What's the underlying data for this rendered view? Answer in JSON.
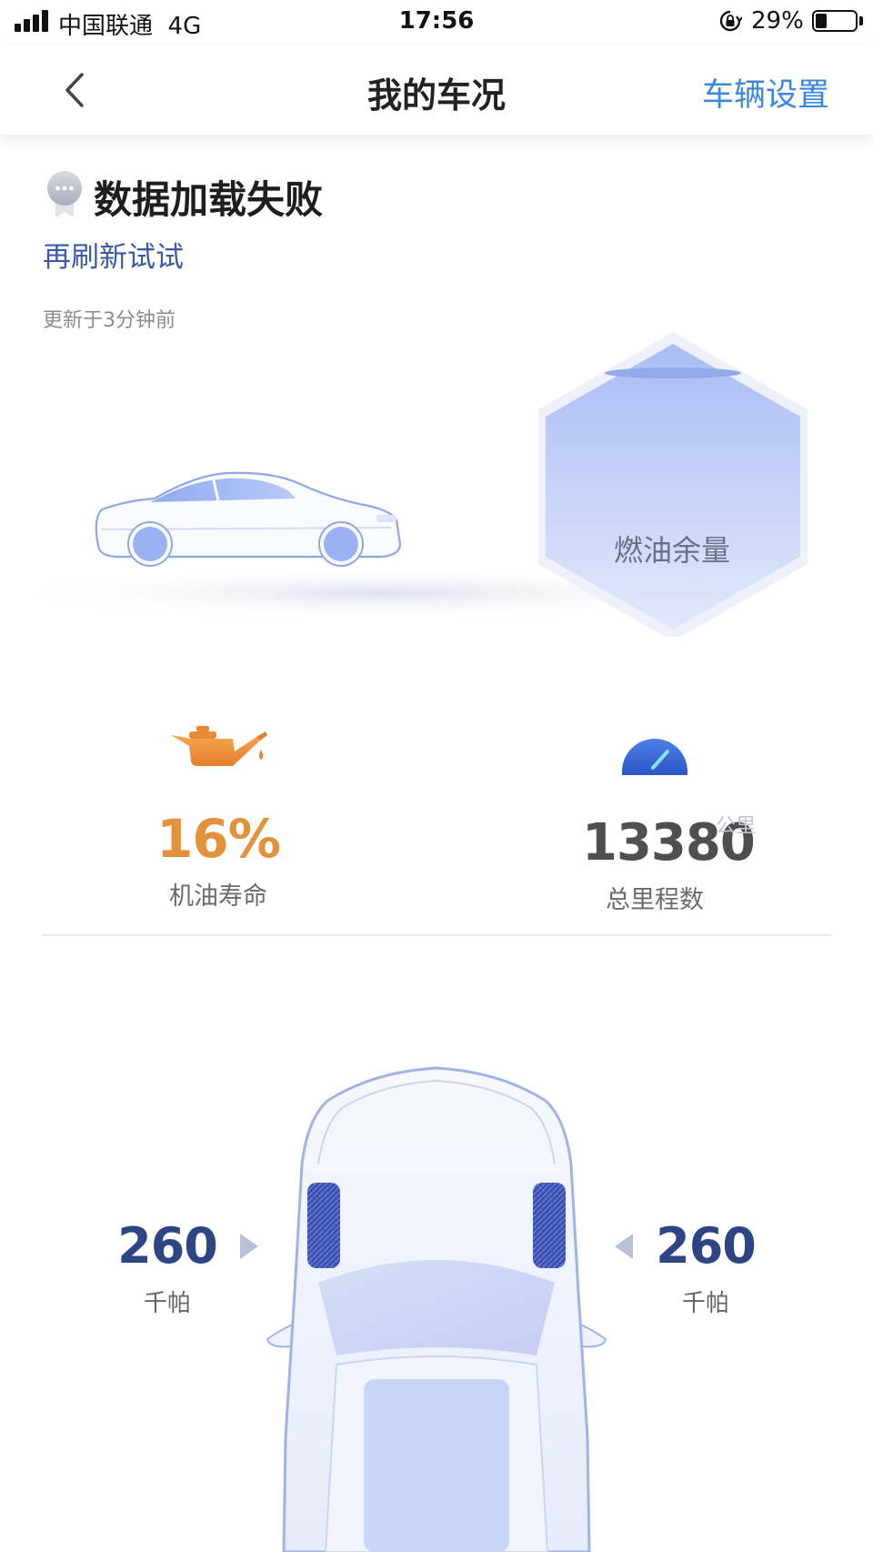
{
  "status_bar": {
    "carrier": "中国联通",
    "network": "4G",
    "time": "17:56",
    "battery_percent": "29%",
    "battery_level": 0.29
  },
  "nav": {
    "title": "我的车况",
    "settings_label": "车辆设置"
  },
  "status": {
    "title": "数据加载失败",
    "refresh_label": "再刷新试试",
    "updated": "更新于3分钟前"
  },
  "fuel": {
    "label": "燃油余量"
  },
  "oil": {
    "value": "16%",
    "label": "机油寿命"
  },
  "odometer": {
    "value": "13380",
    "unit": "公里",
    "label": "总里程数"
  },
  "tires": {
    "front_left": {
      "value": "260",
      "unit": "千帕"
    },
    "front_right": {
      "value": "260",
      "unit": "千帕"
    }
  },
  "colors": {
    "accent_blue": "#3b87e0",
    "link_blue": "#3a5aa6",
    "oil_orange": "#e4923a",
    "tire_navy": "#2d4585"
  }
}
